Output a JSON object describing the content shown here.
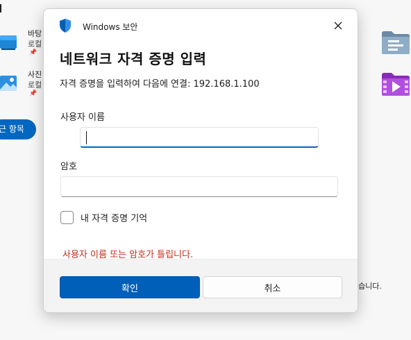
{
  "background": {
    "items": [
      {
        "name": "바탕",
        "sub": "로컬",
        "pin": "📌"
      },
      {
        "name": "사진",
        "sub": "로컬",
        "pin": "📌"
      }
    ],
    "pill_label": "근 항목",
    "right_text": "습니다."
  },
  "dialog": {
    "app_title": "Windows 보안",
    "heading": "네트워크 자격 증명 입력",
    "description": "자격 증명을 입력하여 다음에 연결: 192.168.1.100",
    "username_label": "사용자 이름",
    "username_value": "",
    "password_label": "암호",
    "password_value": "",
    "remember_label": "내 자격 증명 기억",
    "remember_checked": false,
    "error": "사용자 이름 또는 암호가 틀립니다.",
    "ok_label": "확인",
    "cancel_label": "취소"
  },
  "colors": {
    "accent": "#005fb8",
    "error": "#c42b1c",
    "shield": "#0067c0"
  }
}
